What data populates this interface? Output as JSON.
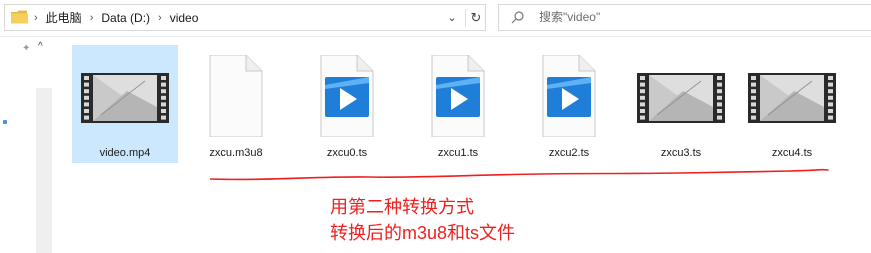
{
  "address_bar": {
    "crumbs": [
      "此电脑",
      "Data (D:)",
      "video"
    ],
    "dropdown_icon": "chevron-down-icon",
    "refresh_icon": "refresh-icon"
  },
  "search": {
    "placeholder": "搜索\"video\""
  },
  "files": [
    {
      "name": "video.mp4",
      "kind": "video-thumbnail",
      "selected": true
    },
    {
      "name": "zxcu.m3u8",
      "kind": "generic-file",
      "selected": false
    },
    {
      "name": "zxcu0.ts",
      "kind": "media-player-file",
      "selected": false
    },
    {
      "name": "zxcu1.ts",
      "kind": "media-player-file",
      "selected": false
    },
    {
      "name": "zxcu2.ts",
      "kind": "media-player-file",
      "selected": false
    },
    {
      "name": "zxcu3.ts",
      "kind": "video-thumbnail",
      "selected": false
    },
    {
      "name": "zxcu4.ts",
      "kind": "video-thumbnail",
      "selected": false
    }
  ],
  "annotation": {
    "line1": "用第二种转换方式",
    "line2": "转换后的m3u8和ts文件",
    "color": "#ee2020"
  },
  "colors": {
    "selection": "#cce8ff",
    "player_blue": "#1f7fd8"
  }
}
